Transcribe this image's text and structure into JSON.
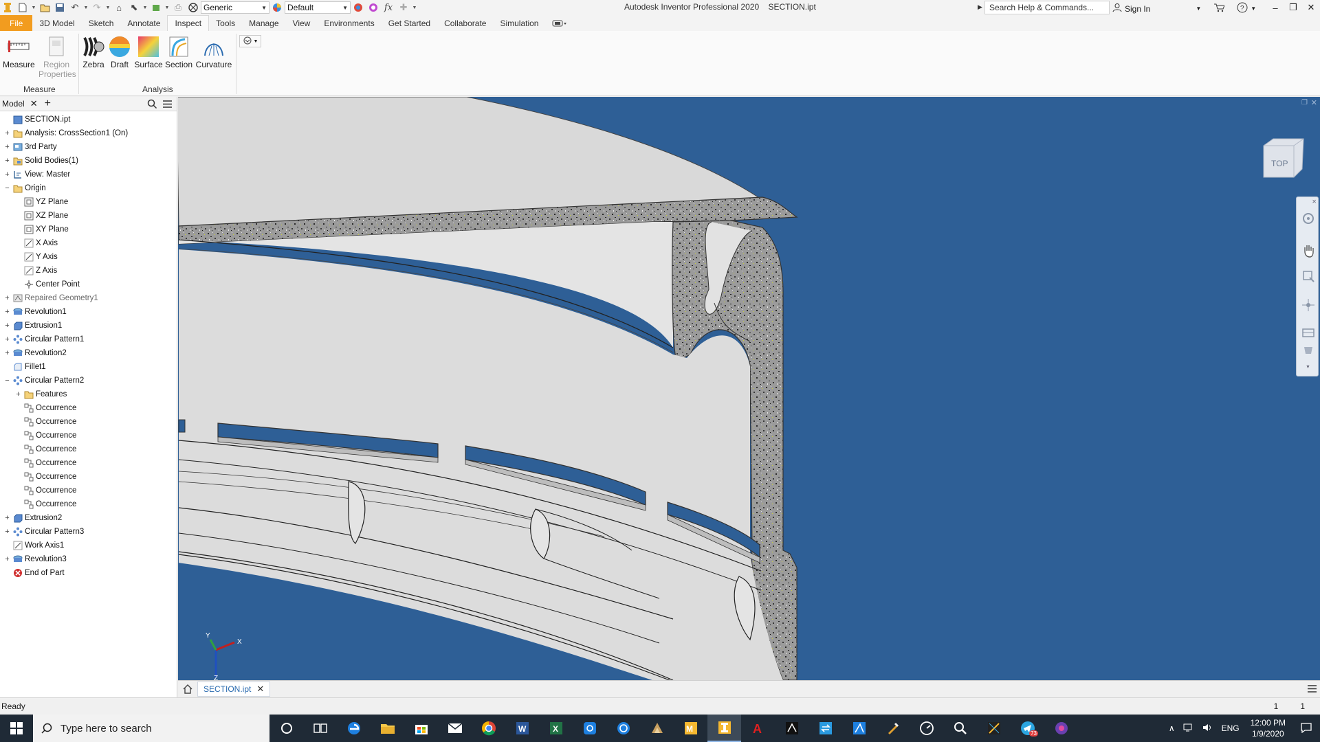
{
  "titlebar": {
    "app_title": "Autodesk Inventor Professional 2020    SECTION.ipt",
    "appearance_combo": "Generic",
    "material_combo": "Default",
    "search_placeholder": "Search Help & Commands...",
    "sign_in": "Sign In"
  },
  "ribbon_tabs": [
    "File",
    "3D Model",
    "Sketch",
    "Annotate",
    "Inspect",
    "Tools",
    "Manage",
    "View",
    "Environments",
    "Get Started",
    "Collaborate",
    "Simulation"
  ],
  "active_tab": "Inspect",
  "ribbon": {
    "measure": "Measure",
    "region_properties_1": "Region",
    "region_properties_2": "Properties",
    "zebra": "Zebra",
    "draft": "Draft",
    "surface": "Surface",
    "section": "Section",
    "curvature": "Curvature",
    "panel_measure": "Measure",
    "panel_analysis": "Analysis"
  },
  "browser": {
    "tab_label": "Model",
    "nodes": [
      {
        "label": "SECTION.ipt",
        "level": 0,
        "exp": "",
        "icon": "part-icon"
      },
      {
        "label": "Analysis: CrossSection1 (On)",
        "level": 0,
        "exp": "+",
        "icon": "folder-icon"
      },
      {
        "label": "3rd Party",
        "level": 0,
        "exp": "+",
        "icon": "third-party-icon"
      },
      {
        "label": "Solid Bodies(1)",
        "level": 0,
        "exp": "+",
        "icon": "solid-bodies-icon"
      },
      {
        "label": "View: Master",
        "level": 0,
        "exp": "+",
        "icon": "view-icon"
      },
      {
        "label": "Origin",
        "level": 0,
        "exp": "−",
        "icon": "folder-icon"
      },
      {
        "label": "YZ Plane",
        "level": 1,
        "exp": "",
        "icon": "plane-icon"
      },
      {
        "label": "XZ Plane",
        "level": 1,
        "exp": "",
        "icon": "plane-icon"
      },
      {
        "label": "XY Plane",
        "level": 1,
        "exp": "",
        "icon": "plane-icon"
      },
      {
        "label": "X Axis",
        "level": 1,
        "exp": "",
        "icon": "axis-icon"
      },
      {
        "label": "Y Axis",
        "level": 1,
        "exp": "",
        "icon": "axis-icon"
      },
      {
        "label": "Z Axis",
        "level": 1,
        "exp": "",
        "icon": "axis-icon"
      },
      {
        "label": "Center Point",
        "level": 1,
        "exp": "",
        "icon": "point-icon"
      },
      {
        "label": "Repaired Geometry1",
        "level": 0,
        "exp": "+",
        "icon": "repaired-geometry-icon"
      },
      {
        "label": "Revolution1",
        "level": 0,
        "exp": "+",
        "icon": "revolve-icon"
      },
      {
        "label": "Extrusion1",
        "level": 0,
        "exp": "+",
        "icon": "extrude-icon"
      },
      {
        "label": "Circular Pattern1",
        "level": 0,
        "exp": "+",
        "icon": "circular-pattern-icon"
      },
      {
        "label": "Revolution2",
        "level": 0,
        "exp": "+",
        "icon": "revolve-icon"
      },
      {
        "label": "Fillet1",
        "level": 0,
        "exp": "",
        "icon": "fillet-icon"
      },
      {
        "label": "Circular Pattern2",
        "level": 0,
        "exp": "−",
        "icon": "circular-pattern-icon"
      },
      {
        "label": "Features",
        "level": 1,
        "exp": "+",
        "icon": "folder-icon"
      },
      {
        "label": "Occurrence",
        "level": 1,
        "exp": "",
        "icon": "occurrence-icon"
      },
      {
        "label": "Occurrence",
        "level": 1,
        "exp": "",
        "icon": "occurrence-icon"
      },
      {
        "label": "Occurrence",
        "level": 1,
        "exp": "",
        "icon": "occurrence-icon"
      },
      {
        "label": "Occurrence",
        "level": 1,
        "exp": "",
        "icon": "occurrence-icon"
      },
      {
        "label": "Occurrence",
        "level": 1,
        "exp": "",
        "icon": "occurrence-icon"
      },
      {
        "label": "Occurrence",
        "level": 1,
        "exp": "",
        "icon": "occurrence-icon"
      },
      {
        "label": "Occurrence",
        "level": 1,
        "exp": "",
        "icon": "occurrence-icon"
      },
      {
        "label": "Occurrence",
        "level": 1,
        "exp": "",
        "icon": "occurrence-icon"
      },
      {
        "label": "Extrusion2",
        "level": 0,
        "exp": "+",
        "icon": "extrude-icon"
      },
      {
        "label": "Circular Pattern3",
        "level": 0,
        "exp": "+",
        "icon": "circular-pattern-icon"
      },
      {
        "label": "Work Axis1",
        "level": 0,
        "exp": "",
        "icon": "axis-icon"
      },
      {
        "label": "Revolution3",
        "level": 0,
        "exp": "+",
        "icon": "revolve-icon"
      },
      {
        "label": "End of Part",
        "level": 0,
        "exp": "",
        "icon": "end-of-part-icon"
      }
    ]
  },
  "viewcube_label": "TOP",
  "axis_labels": {
    "x": "X",
    "y": "Y",
    "z": "Z"
  },
  "document_tab": "SECTION.ipt",
  "status": {
    "text": "Ready",
    "count_1": "1",
    "count_2": "1"
  },
  "taskbar": {
    "search_placeholder": "Type here to search",
    "language": "ENG",
    "time": "12:00 PM",
    "date": "1/9/2020",
    "telegram_badge": "73"
  },
  "colors": {
    "viewport_background": "#2e5f96",
    "file_tab": "#f29c1f",
    "section_fill": "#9a9a9a",
    "part_surface": "#dcdcdc"
  }
}
